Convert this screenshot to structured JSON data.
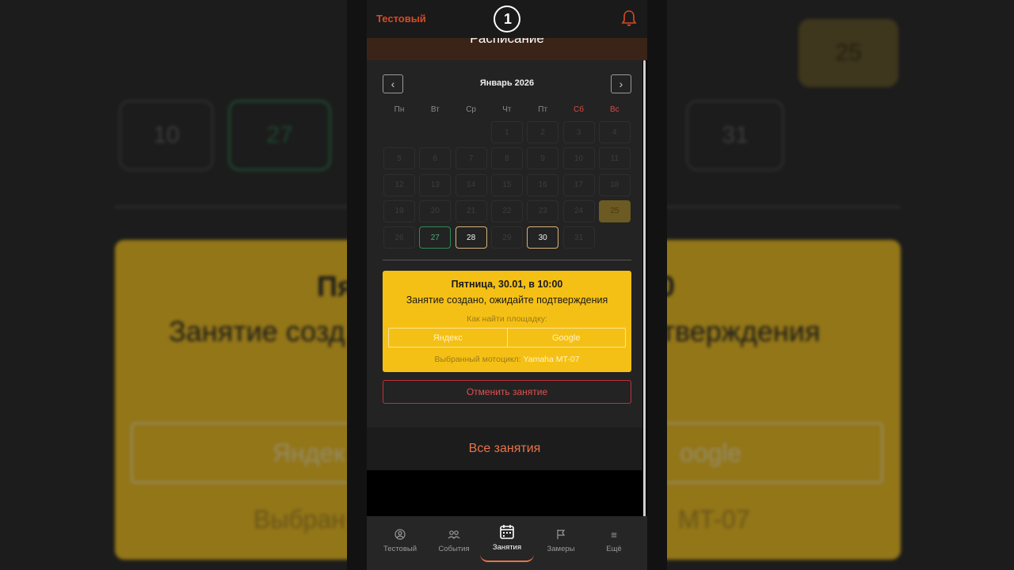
{
  "app": {
    "brand": "Тестовый",
    "logo_glyph": "1"
  },
  "header": {
    "title": "Расписание"
  },
  "calendar": {
    "month_label": "Январь 2026",
    "prev_glyph": "‹",
    "next_glyph": "›",
    "weekdays": [
      "Пн",
      "Вт",
      "Ср",
      "Чт",
      "Пт",
      "Сб",
      "Вс"
    ],
    "days": [
      {
        "n": "1",
        "state": "past"
      },
      {
        "n": "2",
        "state": "past"
      },
      {
        "n": "3",
        "state": "past"
      },
      {
        "n": "4",
        "state": "past"
      },
      {
        "n": "5",
        "state": "past"
      },
      {
        "n": "6",
        "state": "past"
      },
      {
        "n": "7",
        "state": "past"
      },
      {
        "n": "8",
        "state": "past"
      },
      {
        "n": "9",
        "state": "past"
      },
      {
        "n": "10",
        "state": "past"
      },
      {
        "n": "11",
        "state": "past"
      },
      {
        "n": "12",
        "state": "past"
      },
      {
        "n": "13",
        "state": "past"
      },
      {
        "n": "14",
        "state": "past"
      },
      {
        "n": "15",
        "state": "past"
      },
      {
        "n": "16",
        "state": "past"
      },
      {
        "n": "17",
        "state": "past"
      },
      {
        "n": "18",
        "state": "past"
      },
      {
        "n": "19",
        "state": "past"
      },
      {
        "n": "20",
        "state": "past"
      },
      {
        "n": "21",
        "state": "past"
      },
      {
        "n": "22",
        "state": "past"
      },
      {
        "n": "23",
        "state": "past"
      },
      {
        "n": "24",
        "state": "past"
      },
      {
        "n": "25",
        "state": "highlight"
      },
      {
        "n": "26",
        "state": "past"
      },
      {
        "n": "27",
        "state": "green"
      },
      {
        "n": "28",
        "state": "gold"
      },
      {
        "n": "29",
        "state": "past"
      },
      {
        "n": "30",
        "state": "gold"
      },
      {
        "n": "31",
        "state": "past"
      }
    ]
  },
  "booking": {
    "title": "Пятница, 30.01, в 10:00",
    "status": "Занятие создано, ожидайте подтверждения",
    "find_label": "Как найти площадку:",
    "map_yandex": "Яндекс",
    "map_google": "Google",
    "moto_label": "Выбранный мотоцикл:",
    "moto_value": "Yamaha MT-07",
    "cancel_label": "Отменить занятие"
  },
  "all_lessons_label": "Все занятия",
  "tabs": [
    {
      "label": "Тестовый",
      "icon": "user-icon"
    },
    {
      "label": "События",
      "icon": "people-icon"
    },
    {
      "label": "Занятия",
      "icon": "calendar-icon"
    },
    {
      "label": "Замеры",
      "icon": "flag-icon"
    },
    {
      "label": "Ещё",
      "icon": "menu-icon"
    }
  ],
  "background": {
    "cells": [
      "25",
      "27",
      "10",
      "31"
    ],
    "card_line1": "Пя",
    "card_line1b": "00",
    "card_line2": "Занятие созд",
    "card_line2b": "тверждения",
    "card_map_a": "Яндек",
    "card_map_b": "oogle",
    "card_moto_a": "Выбран",
    "card_moto_b": "MT-07"
  },
  "colors": {
    "accent": "#e8734a",
    "brand": "#d84a24",
    "card": "#f5c015",
    "danger": "#c0303a",
    "green": "#2e8b57"
  }
}
